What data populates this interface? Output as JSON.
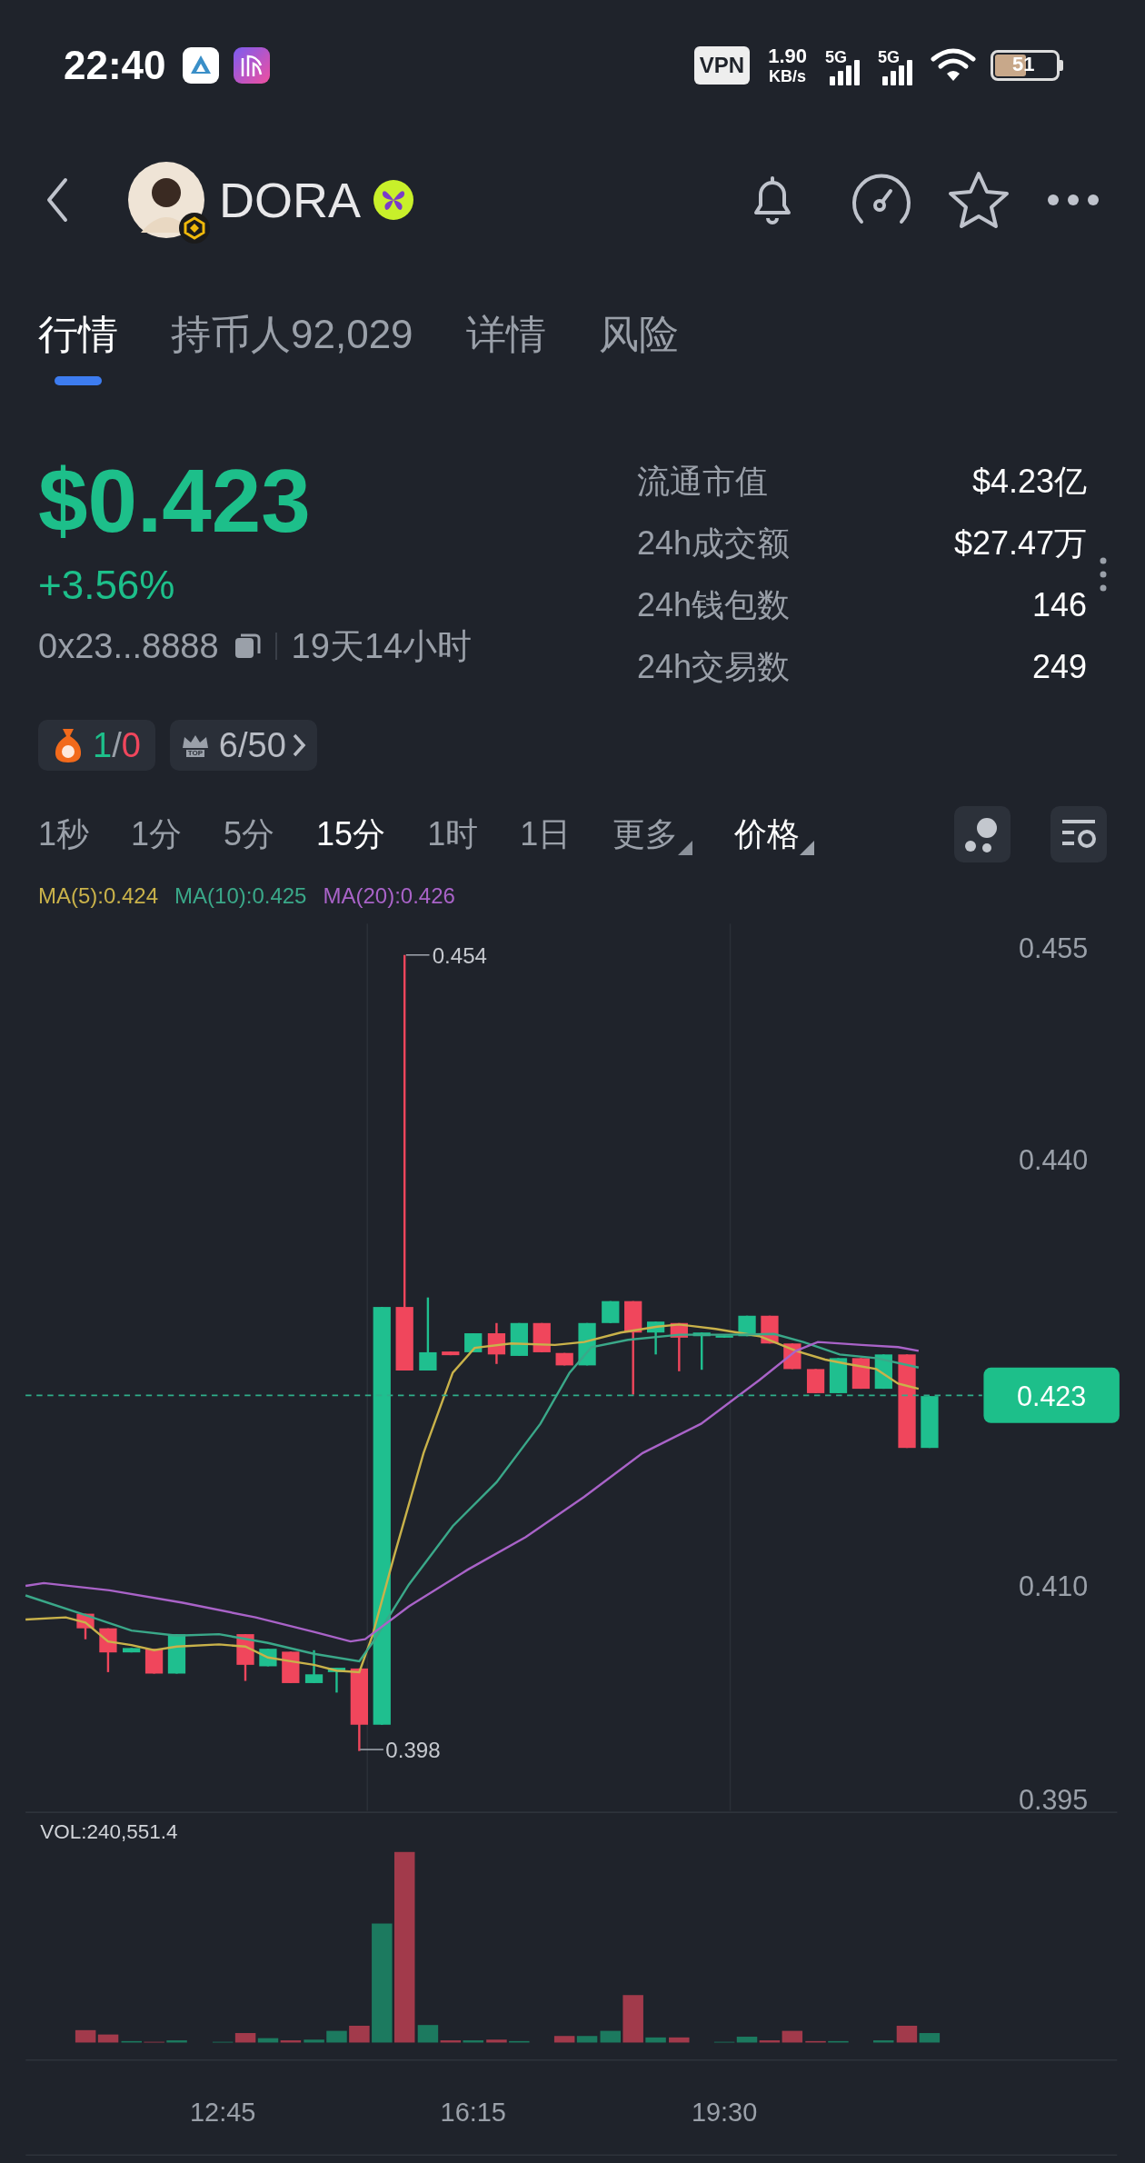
{
  "status_bar": {
    "time": "22:40",
    "vpn": "VPN",
    "speed_value": "1.90",
    "speed_unit": "KB/s",
    "networks": [
      "5G",
      "5G"
    ],
    "battery": "51"
  },
  "header": {
    "token": "DORA"
  },
  "tabs": [
    {
      "label": "行情",
      "selected": true
    },
    {
      "label": "持币人92,029",
      "selected": false
    },
    {
      "label": "详情",
      "selected": false
    },
    {
      "label": "风险",
      "selected": false
    }
  ],
  "price": {
    "value": "$0.423",
    "change": "+3.56%",
    "address": "0x23...8888",
    "age": "19天14小时"
  },
  "stats": [
    {
      "label": "流通市值",
      "value": "$4.23亿"
    },
    {
      "label": "24h成交额",
      "value": "$27.47万"
    },
    {
      "label": "24h钱包数",
      "value": "146"
    },
    {
      "label": "24h交易数",
      "value": "249"
    }
  ],
  "badges": {
    "bag_positive": "1",
    "bag_separator": "/",
    "bag_negative": "0",
    "top_icon_text": "TOP",
    "top_rank": "6/50"
  },
  "intervals": [
    {
      "label": "1秒",
      "selected": false
    },
    {
      "label": "1分",
      "selected": false
    },
    {
      "label": "5分",
      "selected": false
    },
    {
      "label": "15分",
      "selected": true
    },
    {
      "label": "1时",
      "selected": false
    },
    {
      "label": "1日",
      "selected": false
    }
  ],
  "dropdowns": [
    {
      "label": "更多",
      "highlighted": false
    },
    {
      "label": "价格",
      "highlighted": true
    }
  ],
  "ma_legend": [
    {
      "label": "MA(5):0.424",
      "color": "#c9b24a"
    },
    {
      "label": "MA(10):0.425",
      "color": "#3aa889"
    },
    {
      "label": "MA(20):0.426",
      "color": "#a963c8"
    }
  ],
  "price_chart": {
    "axis_labels": [
      "0.455",
      "0.440",
      "0.410",
      "0.395"
    ],
    "high_label": "0.454",
    "low_label": "0.398",
    "current_price": "0.423"
  },
  "volume": {
    "label": "VOL:240,551.4",
    "time_labels": [
      "12:45",
      "16:15",
      "19:30"
    ]
  }
}
